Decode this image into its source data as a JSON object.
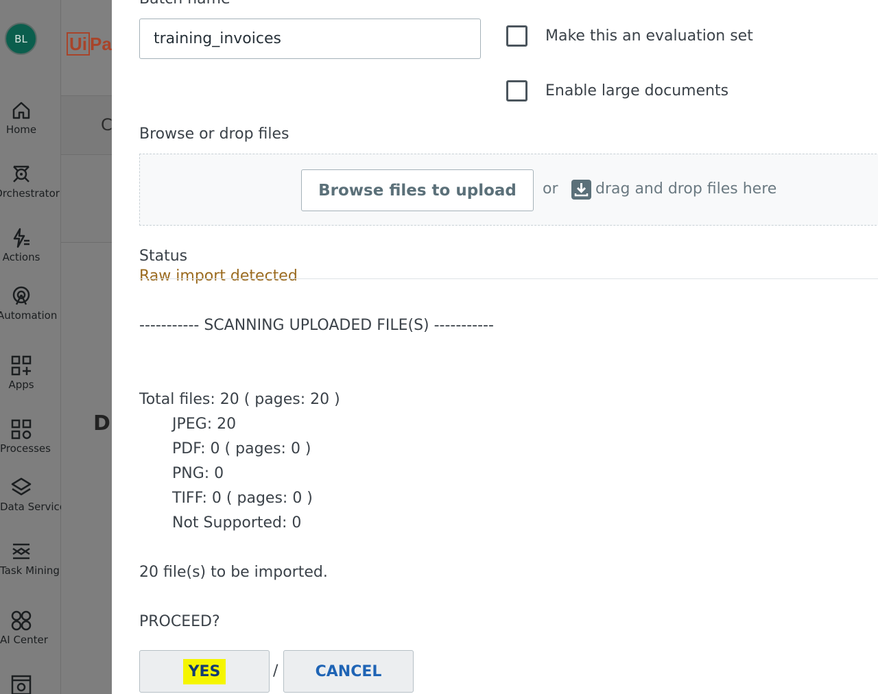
{
  "nav": {
    "avatar_initials": "BL",
    "items": [
      {
        "label": "Home",
        "icon": "home-icon"
      },
      {
        "label": "Orchestrator",
        "icon": "orchestrator-icon"
      },
      {
        "label": "Actions",
        "icon": "actions-icon"
      },
      {
        "label": "Automation Hub",
        "icon": "automation-hub-icon"
      },
      {
        "label": "Apps",
        "icon": "apps-icon"
      },
      {
        "label": "Processes",
        "icon": "processes-icon"
      },
      {
        "label": "Data Service",
        "icon": "data-service-icon"
      },
      {
        "label": "Task Mining",
        "icon": "task-mining-icon"
      },
      {
        "label": "AI Center",
        "icon": "ai-center-icon"
      }
    ]
  },
  "background": {
    "logo_box": "Ui",
    "logo_rest": "Pa",
    "letter_c": "C",
    "letter_d": "D"
  },
  "dialog": {
    "batch_label": "Batch name",
    "batch_value": "training_invoices",
    "eval_label": "Make this an evaluation set",
    "large_label": "Enable large documents",
    "browse_label": "Browse or drop files",
    "browse_button": "Browse files to upload",
    "or_text": "or",
    "drag_text": "drag and drop files here",
    "status_title": "Status",
    "status_clipped": "Raw import detected",
    "scanning": "----------- SCANNING UPLOADED FILE(S) -----------",
    "total": "Total files: 20 ( pages: 20 )",
    "jpeg": "JPEG: 20",
    "pdf": "PDF: 0 ( pages: 0 )",
    "png": "PNG: 0",
    "tiff": "TIFF: 0 ( pages: 0 )",
    "not_supported": "Not Supported: 0",
    "to_import": "20 file(s) to be imported.",
    "proceed": "PROCEED?",
    "yes": "YES",
    "slash": "/",
    "cancel": "CANCEL"
  },
  "colors": {
    "highlight": "#f5f500",
    "status_warning": "#9a6a1f",
    "link_blue": "#1f64b5"
  }
}
